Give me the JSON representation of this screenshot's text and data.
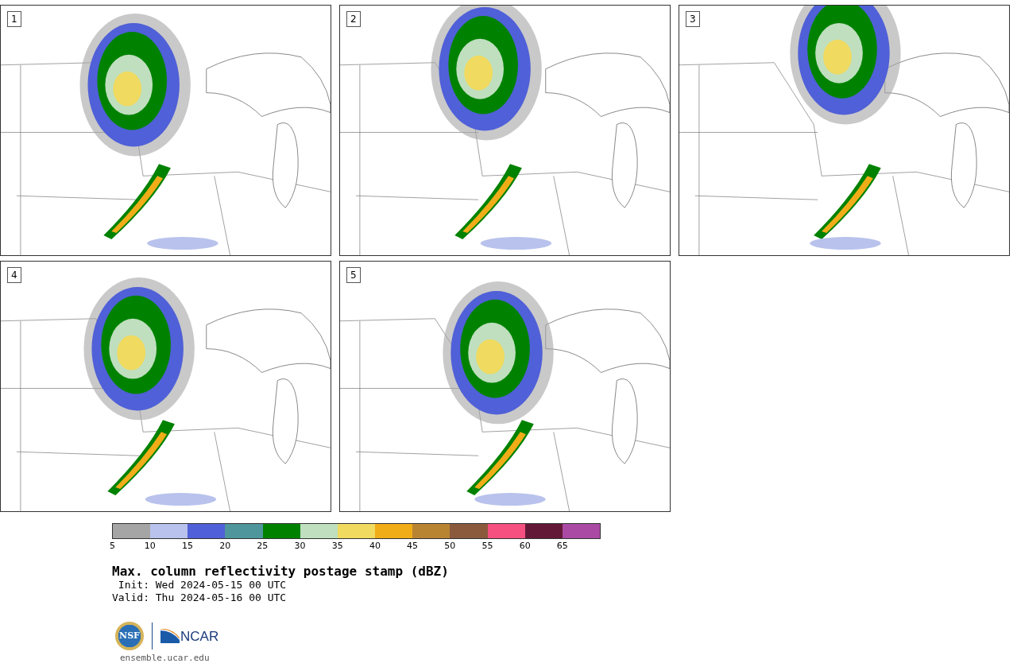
{
  "panels": [
    {
      "label": "1"
    },
    {
      "label": "2"
    },
    {
      "label": "3"
    },
    {
      "label": "4"
    },
    {
      "label": "5"
    }
  ],
  "legend": {
    "bins": [
      {
        "color": "#a5a5a5"
      },
      {
        "color": "#b8c2ec"
      },
      {
        "color": "#5060d8"
      },
      {
        "color": "#4f969c"
      },
      {
        "color": "#008200"
      },
      {
        "color": "#bfdfbf"
      },
      {
        "color": "#f0da60"
      },
      {
        "color": "#f0ad18"
      },
      {
        "color": "#b98432"
      },
      {
        "color": "#8b5a3c"
      },
      {
        "color": "#f55080"
      },
      {
        "color": "#641838"
      },
      {
        "color": "#aa4aa4"
      }
    ],
    "ticks": [
      "5",
      "10",
      "15",
      "20",
      "25",
      "30",
      "35",
      "40",
      "45",
      "50",
      "55",
      "60",
      "65"
    ]
  },
  "title": "Max. column reflectivity postage stamp (dBZ)",
  "init": " Init: Wed 2024-05-15 00 UTC",
  "valid": "Valid: Thu 2024-05-16 00 UTC",
  "logos": [
    {
      "text": "NSF"
    },
    {
      "text": "NCAR"
    }
  ],
  "url": "ensemble.ucar.edu"
}
